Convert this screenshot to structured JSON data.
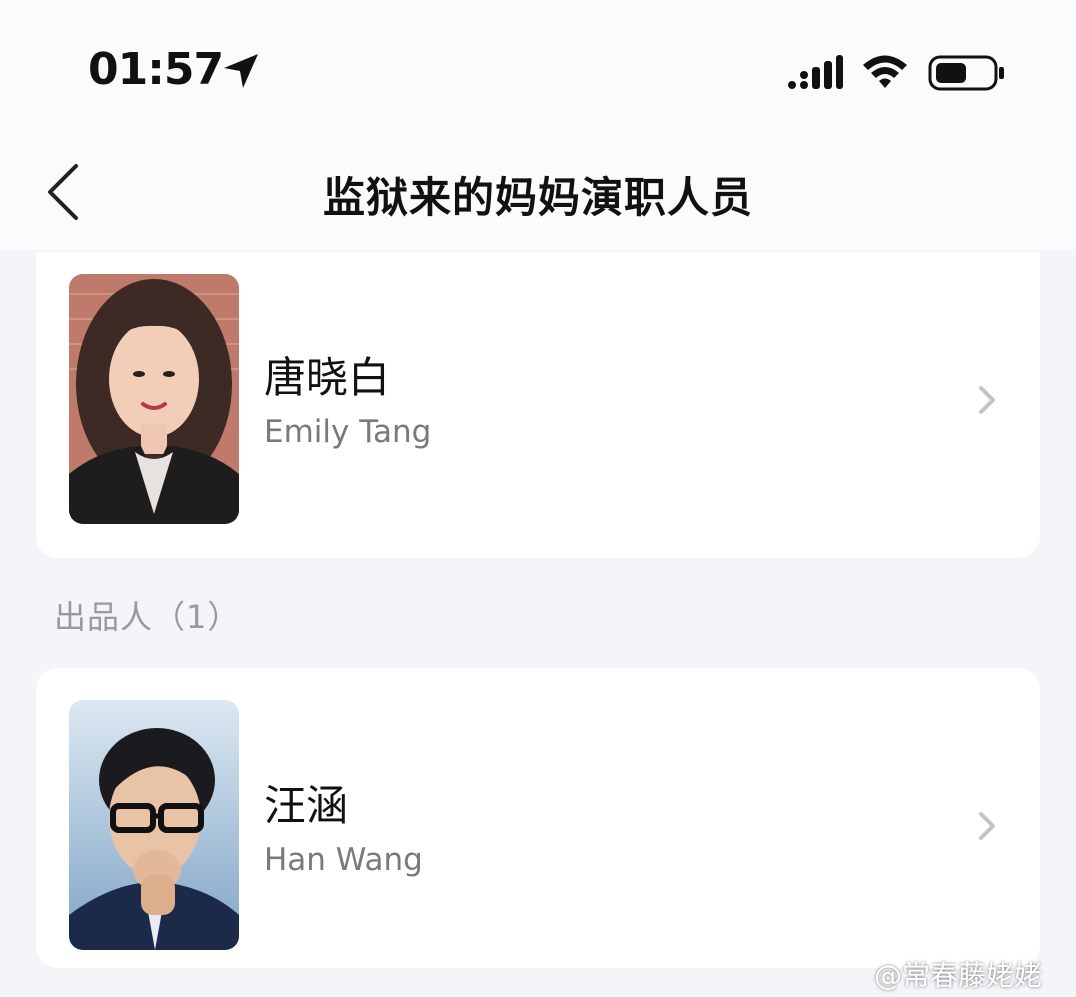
{
  "status_bar": {
    "time": "01:57"
  },
  "nav": {
    "title": "监狱来的妈妈演职人员"
  },
  "cast": [
    {
      "name_cn": "唐晓白",
      "name_en": "Emily Tang"
    }
  ],
  "producers_section": {
    "header": "出品人（1）",
    "people": [
      {
        "name_cn": "汪涵",
        "name_en": "Han Wang"
      }
    ]
  },
  "watermark": "@常春藤姥姥",
  "colors": {
    "background": "#f4f5f8",
    "card": "#ffffff",
    "title": "#111111",
    "secondary_text": "#7a7a7a",
    "section_header": "#9a9a9a"
  }
}
